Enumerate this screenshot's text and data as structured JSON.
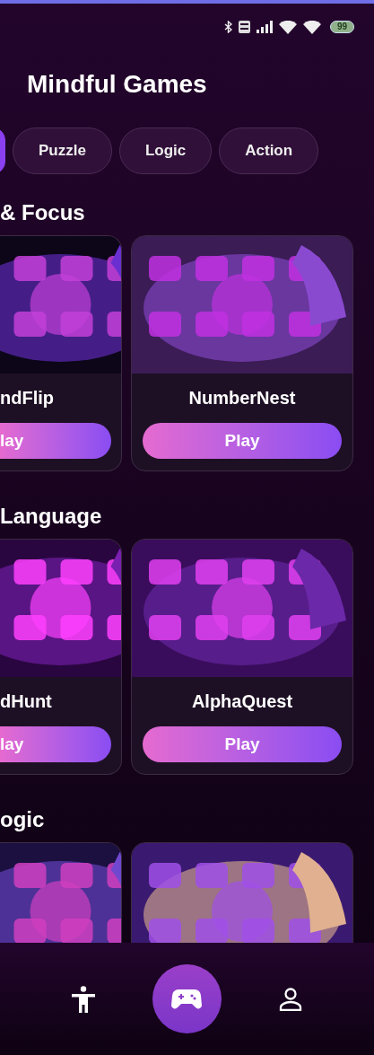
{
  "status_bar": {
    "battery": "99"
  },
  "title": "Mindful Games",
  "chips": [
    {
      "selected": true
    },
    {
      "label": "Puzzle",
      "selected": false
    },
    {
      "label": "Logic",
      "selected": false
    },
    {
      "label": "Action",
      "selected": false
    }
  ],
  "sections": [
    {
      "title": "& Focus",
      "games": [
        {
          "kind": "picture",
          "title": "ndFlip",
          "button": "lay"
        },
        {
          "kind": "picture",
          "title": "NumberNest",
          "button": "Play"
        }
      ]
    },
    {
      "title": "Language",
      "games": [
        {
          "kind": "picture",
          "title": "dHunt",
          "button": "lay"
        },
        {
          "kind": "picture",
          "title": "AlphaQuest",
          "button": "Play"
        }
      ]
    },
    {
      "title": "ogic"
    }
  ],
  "nav": [
    {
      "selected": false
    },
    {
      "selected": true
    },
    {
      "selected": false
    }
  ]
}
